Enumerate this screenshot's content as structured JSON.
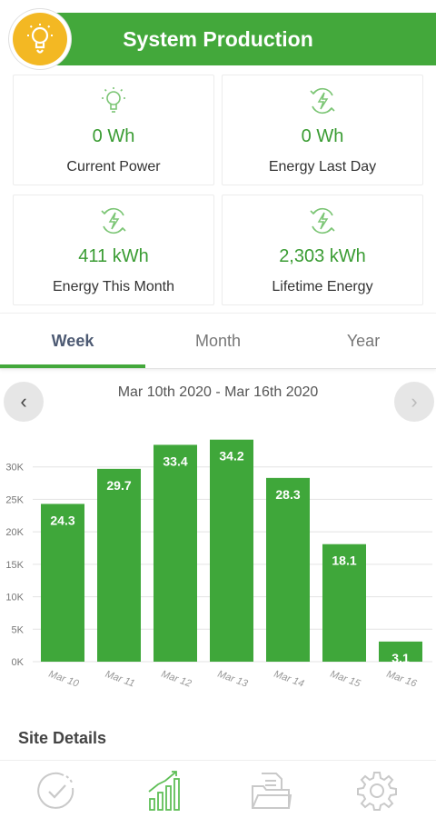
{
  "header": {
    "title": "System Production",
    "logo_icon": "lightbulb-icon",
    "accent_color": "#43a83b",
    "logo_color": "#f3b823"
  },
  "stats": [
    {
      "icon": "lightbulb-icon",
      "value": "0 Wh",
      "label": "Current Power"
    },
    {
      "icon": "energy-cycle-icon",
      "value": "0 Wh",
      "label": "Energy Last Day"
    },
    {
      "icon": "energy-cycle-icon",
      "value": "411 kWh",
      "label": "Energy This Month"
    },
    {
      "icon": "energy-cycle-icon",
      "value": "2,303 kWh",
      "label": "Lifetime Energy"
    }
  ],
  "tabs": [
    {
      "label": "Week",
      "active": true
    },
    {
      "label": "Month",
      "active": false
    },
    {
      "label": "Year",
      "active": false
    }
  ],
  "date_nav": {
    "prev_label": "‹",
    "next_label": "›",
    "range": "Mar 10th 2020  -  Mar 16th 2020"
  },
  "chart_data": {
    "type": "bar",
    "categories": [
      "Mar 10",
      "Mar 11",
      "Mar 12",
      "Mar 13",
      "Mar 14",
      "Mar 15",
      "Mar 16"
    ],
    "values": [
      24.3,
      29.7,
      33.4,
      34.2,
      28.3,
      18.1,
      3.1
    ],
    "value_labels": [
      "24.3",
      "29.7",
      "33.4",
      "34.2",
      "28.3",
      "18.1",
      "3.1"
    ],
    "y_ticks": [
      0,
      5000,
      10000,
      15000,
      20000,
      25000,
      30000
    ],
    "y_tick_labels": [
      "0K",
      "5K",
      "10K",
      "15K",
      "20K",
      "25K",
      "30K"
    ],
    "ylim": [
      0,
      35000
    ],
    "unit_multiplier": 1000,
    "bar_color": "#3fa73a",
    "grid": true,
    "title": "",
    "xlabel": "",
    "ylabel": ""
  },
  "site_details": {
    "label": "Site Details"
  },
  "bottom_nav": [
    {
      "icon": "check-circle-icon",
      "active": false
    },
    {
      "icon": "bar-chart-icon",
      "active": true
    },
    {
      "icon": "documents-folder-icon",
      "active": false
    },
    {
      "icon": "gear-icon",
      "active": false
    }
  ]
}
